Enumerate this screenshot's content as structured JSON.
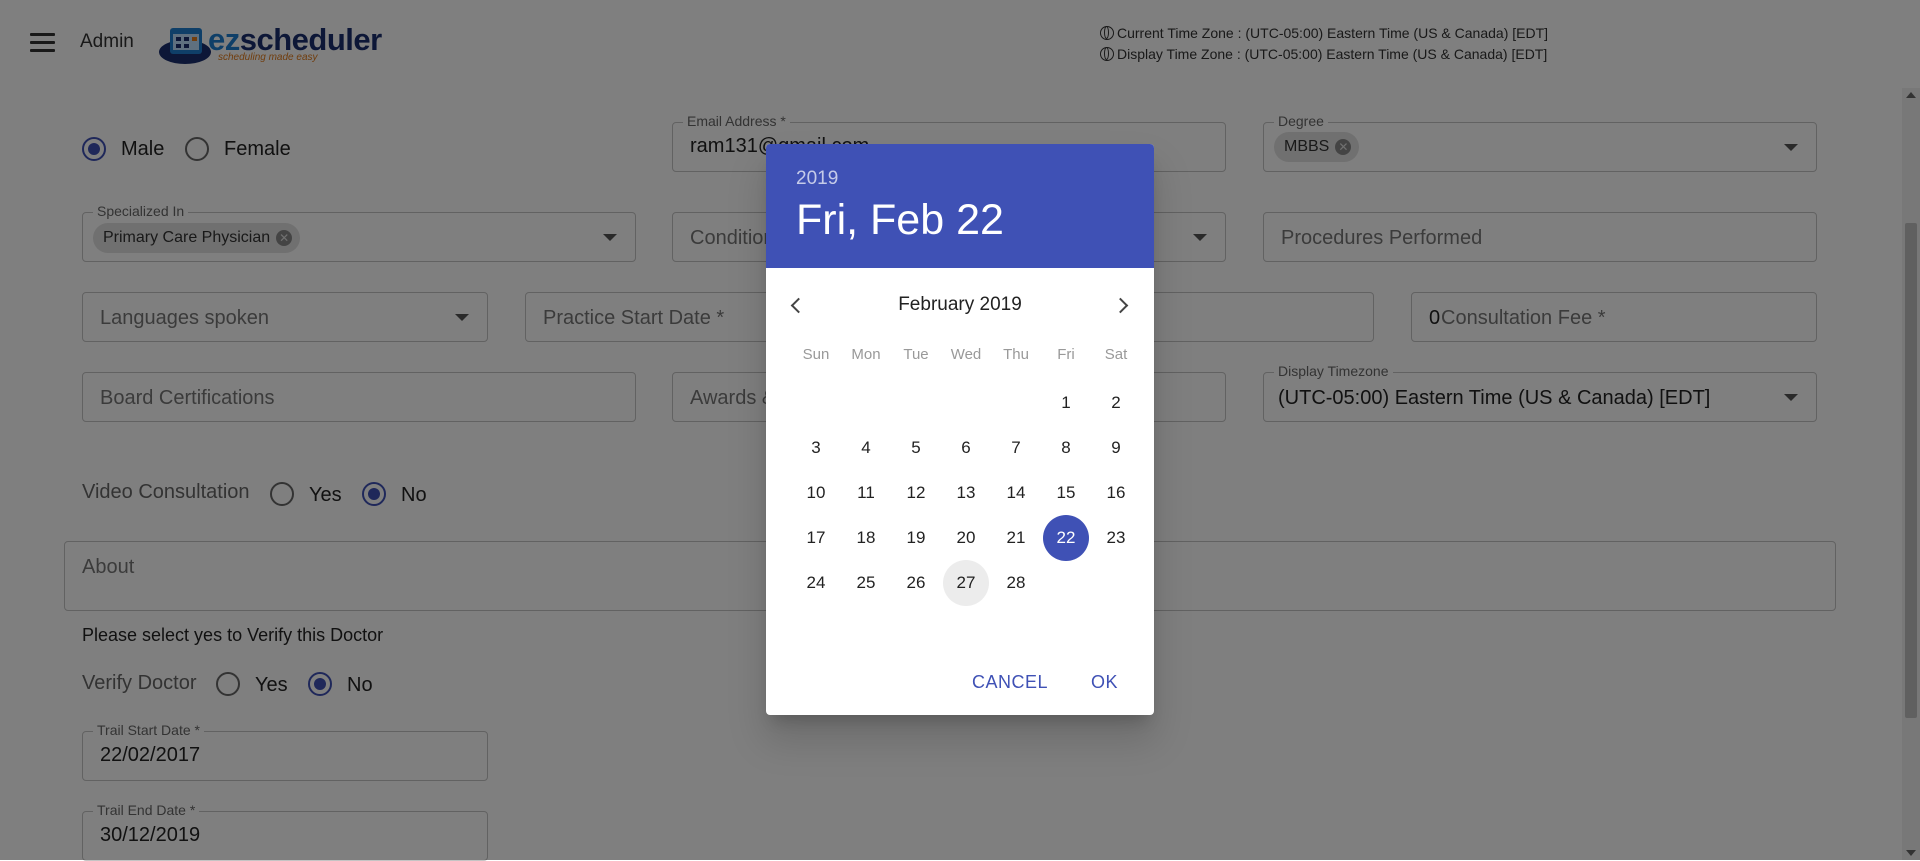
{
  "header": {
    "role": "Admin",
    "logo": {
      "brand_prefix": "ez",
      "brand_suffix": "scheduler",
      "tagline": "scheduling made easy"
    },
    "current_tz": "Current Time Zone : (UTC-05:00) Eastern Time (US & Canada) [EDT]",
    "display_tz": "Display Time Zone : (UTC-05:00) Eastern Time (US & Canada) [EDT]"
  },
  "form": {
    "gender": {
      "male": "Male",
      "female": "Female",
      "selected": "Male"
    },
    "email": {
      "label": "Email Address *",
      "value": "ram131@gmail.com"
    },
    "degree": {
      "label": "Degree",
      "chip": "MBBS"
    },
    "specialized": {
      "label": "Specialized In",
      "chip": "Primary Care Physician"
    },
    "conditions": {
      "placeholder": "Conditions Treated"
    },
    "procedures": {
      "placeholder": "Procedures Performed"
    },
    "languages": {
      "placeholder": "Languages spoken"
    },
    "practice_start": {
      "placeholder": "Practice Start Date *"
    },
    "consultation_fee": {
      "value": "0",
      "placeholder": "Consultation Fee *"
    },
    "board_cert": {
      "placeholder": "Board Certifications"
    },
    "awards": {
      "placeholder": "Awards & Recognitions"
    },
    "display_timezone": {
      "label": "Display Timezone",
      "value": "(UTC-05:00) Eastern Time (US & Canada) [EDT]"
    },
    "video": {
      "label": "Video Consultation",
      "yes": "Yes",
      "no": "No",
      "selected": "No"
    },
    "about": {
      "placeholder": "About"
    },
    "verify_note": "Please select yes to Verify this Doctor",
    "verify": {
      "label": "Verify Doctor",
      "yes": "Yes",
      "no": "No",
      "selected": "No"
    },
    "trail_start": {
      "label": "Trail Start Date *",
      "value": "22/02/2017"
    },
    "trail_end": {
      "label": "Trail End Date *",
      "value": "30/12/2019"
    }
  },
  "datepicker": {
    "year": "2019",
    "selected_label": "Fri, Feb 22",
    "month_label": "February 2019",
    "weekdays": [
      "Sun",
      "Mon",
      "Tue",
      "Wed",
      "Thu",
      "Fri",
      "Sat"
    ],
    "first_weekday": 5,
    "days_in_month": 28,
    "selected_day": 22,
    "hovered_day": 27,
    "cancel": "CANCEL",
    "ok": "OK"
  },
  "colors": {
    "accent": "#3f51b5",
    "overlay": "rgba(0,0,0,0.5)"
  }
}
